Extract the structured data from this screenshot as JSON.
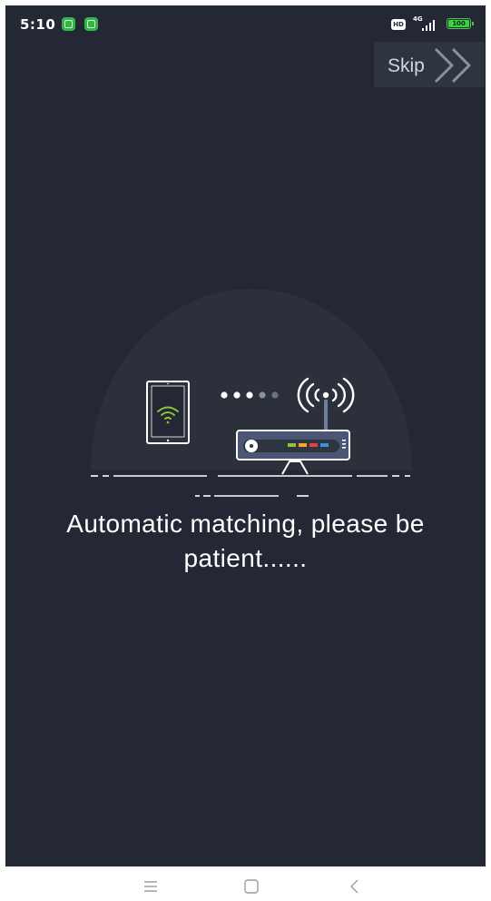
{
  "status_bar": {
    "time": "5:10",
    "notification_icons": [
      "app-notification-icon",
      "app-notification-icon"
    ],
    "hd_badge": "HD",
    "network_type": "4G",
    "battery_level": "100",
    "battery_color": "#3fcf45",
    "signal_icon": "signal-bars-icon"
  },
  "header": {
    "skip_label": "Skip",
    "skip_icon": "double-chevron-right-icon"
  },
  "illustration": {
    "icons": [
      "tablet-icon",
      "wifi-icon",
      "progress-dots",
      "wifi-signal-icon",
      "router-icon"
    ],
    "progress_dots_total": 5,
    "progress_dots_active": 3,
    "accent_color": "#8cc63f",
    "router_led_colors": [
      "#8cc63f",
      "#f5a623",
      "#e8413d",
      "#3a8ee6"
    ]
  },
  "message": {
    "text": "Automatic matching, please be patient......"
  },
  "colors": {
    "background": "#232834",
    "skip_button_bg": "#2e3440",
    "circle_bg": "#2b303b"
  },
  "nav_bar": {
    "buttons": [
      "menu-icon",
      "home-icon",
      "back-icon"
    ]
  }
}
